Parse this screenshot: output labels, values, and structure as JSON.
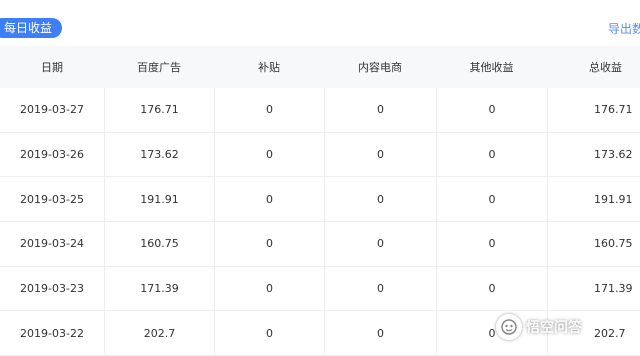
{
  "header": {
    "badge_label": "每日收益",
    "export_label": "导出数"
  },
  "table": {
    "columns": [
      "日期",
      "百度广告",
      "补贴",
      "内容电商",
      "其他收益",
      "总收益"
    ],
    "rows": [
      [
        "2019-03-27",
        "176.71",
        "0",
        "0",
        "0",
        "176.71"
      ],
      [
        "2019-03-26",
        "173.62",
        "0",
        "0",
        "0",
        "173.62"
      ],
      [
        "2019-03-25",
        "191.91",
        "0",
        "0",
        "0",
        "191.91"
      ],
      [
        "2019-03-24",
        "160.75",
        "0",
        "0",
        "0",
        "160.75"
      ],
      [
        "2019-03-23",
        "171.39",
        "0",
        "0",
        "0",
        "171.39"
      ],
      [
        "2019-03-22",
        "202.7",
        "0",
        "0",
        "0",
        "202.7"
      ]
    ]
  },
  "watermark": {
    "text": "悟空问答"
  }
}
